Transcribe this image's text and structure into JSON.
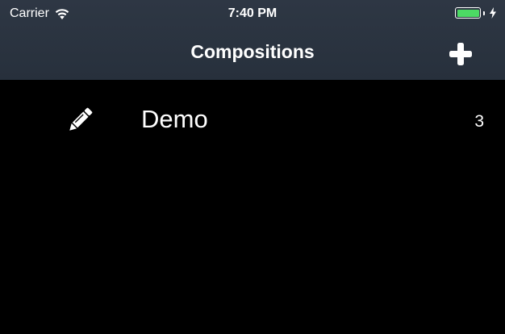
{
  "status_bar": {
    "carrier": "Carrier",
    "time": "7:40 PM",
    "battery_level": 1.0,
    "battery_color": "#4cd964",
    "icons": [
      "wifi-icon",
      "battery-icon",
      "charging-bolt-icon"
    ]
  },
  "nav": {
    "title": "Compositions",
    "add_icon": "plus-icon"
  },
  "compositions": [
    {
      "name": "Demo",
      "count": "3",
      "icon": "pencil-icon"
    }
  ],
  "colors": {
    "nav_background": "#2b3440",
    "list_background": "#000000",
    "text": "#ffffff"
  }
}
